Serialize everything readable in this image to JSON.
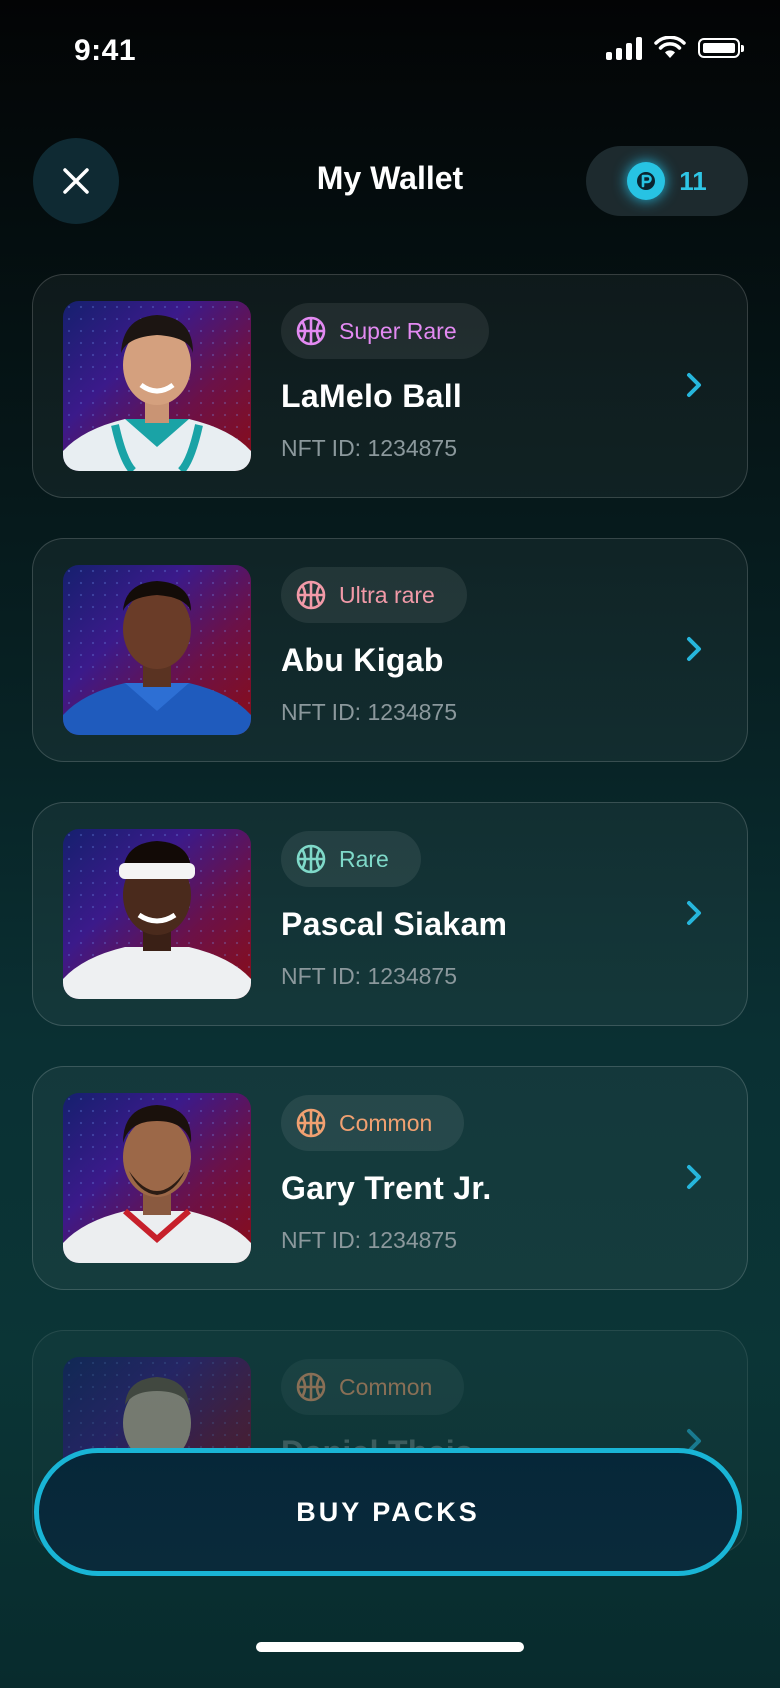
{
  "status_bar": {
    "time": "9:41"
  },
  "header": {
    "title": "My Wallet",
    "points": "11"
  },
  "cards": [
    {
      "rarity": "Super Rare",
      "rarity_color": "#e38af2",
      "name": "LaMelo Ball",
      "nft_id": "NFT ID: 1234875",
      "icon": "basketball-icon"
    },
    {
      "rarity": "Ultra rare",
      "rarity_color": "#f29aa8",
      "name": "Abu Kigab",
      "nft_id": "NFT ID: 1234875",
      "icon": "basketball-icon"
    },
    {
      "rarity": "Rare",
      "rarity_color": "#7fd9c9",
      "name": "Pascal Siakam",
      "nft_id": "NFT ID: 1234875",
      "icon": "basketball-icon"
    },
    {
      "rarity": "Common",
      "rarity_color": "#f0a071",
      "name": "Gary Trent Jr.",
      "nft_id": "NFT ID: 1234875",
      "icon": "basketball-icon"
    },
    {
      "rarity": "Common",
      "rarity_color": "#f0a071",
      "name": "Daniel Theis",
      "nft_id": "",
      "icon": "basketball-icon"
    }
  ],
  "footer": {
    "buy_label": "BUY PACKS"
  },
  "colors": {
    "accent": "#19b5d6",
    "chevron": "#26b6dc"
  }
}
